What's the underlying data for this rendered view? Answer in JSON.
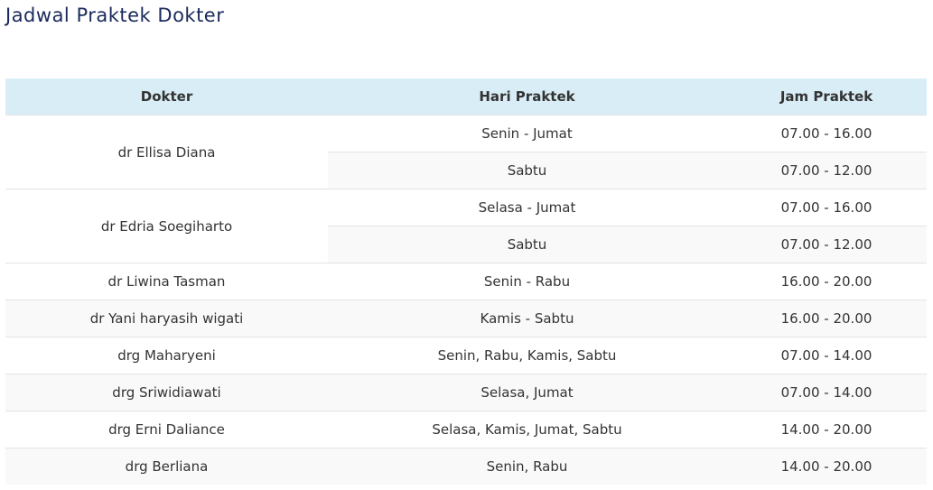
{
  "page": {
    "title": "Jadwal Praktek Dokter"
  },
  "table": {
    "headers": [
      "Dokter",
      "Hari Praktek",
      "Jam Praktek"
    ],
    "rows": [
      {
        "doctor": "dr Ellisa Diana",
        "days": "Senin - Jumat",
        "hours": "07.00 - 16.00"
      },
      {
        "doctor": "",
        "days": "Sabtu",
        "hours": "07.00 - 12.00"
      },
      {
        "doctor": "dr Edria Soegiharto",
        "days": "Selasa - Jumat",
        "hours": "07.00 - 16.00"
      },
      {
        "doctor": "",
        "days": "Sabtu",
        "hours": "07.00 - 12.00"
      },
      {
        "doctor": "dr Liwina Tasman",
        "days": "Senin - Rabu",
        "hours": "16.00 - 20.00"
      },
      {
        "doctor": "dr Yani haryasih wigati",
        "days": "Kamis - Sabtu",
        "hours": "16.00 - 20.00"
      },
      {
        "doctor": "drg Maharyeni",
        "days": "Senin, Rabu, Kamis, Sabtu",
        "hours": "07.00 - 14.00"
      },
      {
        "doctor": "drg Sriwidiawati",
        "days": "Selasa, Jumat",
        "hours": "07.00 - 14.00"
      },
      {
        "doctor": "drg Erni Daliance",
        "days": "Selasa, Kamis, Jumat, Sabtu",
        "hours": "14.00 - 20.00"
      },
      {
        "doctor": "drg Berliana",
        "days": "Senin, Rabu",
        "hours": "14.00 - 20.00"
      }
    ]
  },
  "colors": {
    "header_bg": "#d9edf7",
    "title": "#1a2a5c",
    "stripe": "#f9f9f9"
  }
}
